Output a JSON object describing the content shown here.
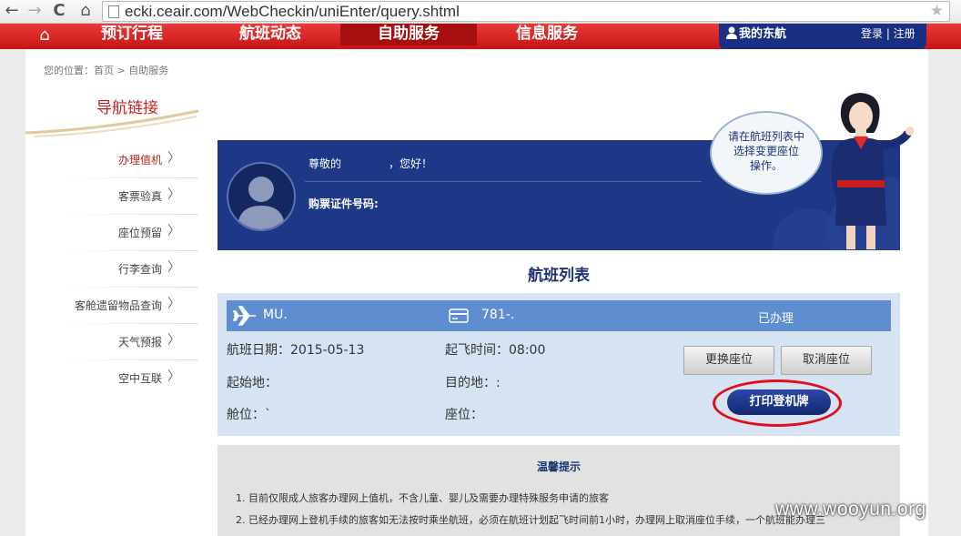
{
  "browser": {
    "url": "ecki.ceair.com/WebCheckin/uniEnter/query.shtml",
    "back_glyph": "←",
    "forward_glyph": "→",
    "reload_glyph": "C",
    "home_glyph": "⌂",
    "star_glyph": "★"
  },
  "site_nav": {
    "home_glyph": "⌂",
    "items": [
      {
        "label": "预订行程"
      },
      {
        "label": "航班动态"
      },
      {
        "label": "自助服务",
        "active": true
      },
      {
        "label": "信息服务"
      }
    ],
    "my_account": "我的东航",
    "login": "登录 | 注册"
  },
  "breadcrumb": "您的位置：首页 > 自助服务",
  "sidebar": {
    "title": "导航链接",
    "chevron": "〉",
    "items": [
      {
        "label": "办理值机",
        "active": true
      },
      {
        "label": "客票验真"
      },
      {
        "label": "座位预留"
      },
      {
        "label": "行李查询"
      },
      {
        "label": "客舱遗留物品查询"
      },
      {
        "label": "天气预报"
      },
      {
        "label": "空中互联"
      }
    ]
  },
  "banner": {
    "greeting_prefix": "尊敬的",
    "greeting_suffix": "，您好！",
    "id_label": "购票证件号码:",
    "speech": [
      "请在航班列表中",
      "选择变更座位",
      "操作。"
    ]
  },
  "flight_list": {
    "title": "航班列表",
    "flight_no": "MU.",
    "ticket_no": "781-.",
    "status": "已办理",
    "date_label": "航班日期：2015-05-13",
    "time_label": "起飞时间：08:00",
    "origin_label": "起始地：",
    "dest_label": "目的地：:",
    "cabin_label": "舱位：`",
    "seat_label": "座位：",
    "change_seat": "更换座位",
    "cancel_seat": "取消座位",
    "print_pass": "打印登机牌"
  },
  "tips": {
    "title": "温馨提示",
    "items": [
      "1. 目前仅限成人旅客办理网上值机，不含儿童、婴儿及需要办理特殊服务申请的旅客",
      "2. 已经办理网上登机手续的旅客如无法按时乘坐航班，必须在航班计划起飞时间前1小时，办理网上取消座位手续，一个航班能办理三"
    ]
  },
  "watermark": "www.wooyun.org",
  "colors": {
    "nav_red": "#d52121",
    "banner_blue": "#1e3887",
    "flight_head_blue": "#5f8ed0",
    "highlight_red": "#e0101a"
  }
}
